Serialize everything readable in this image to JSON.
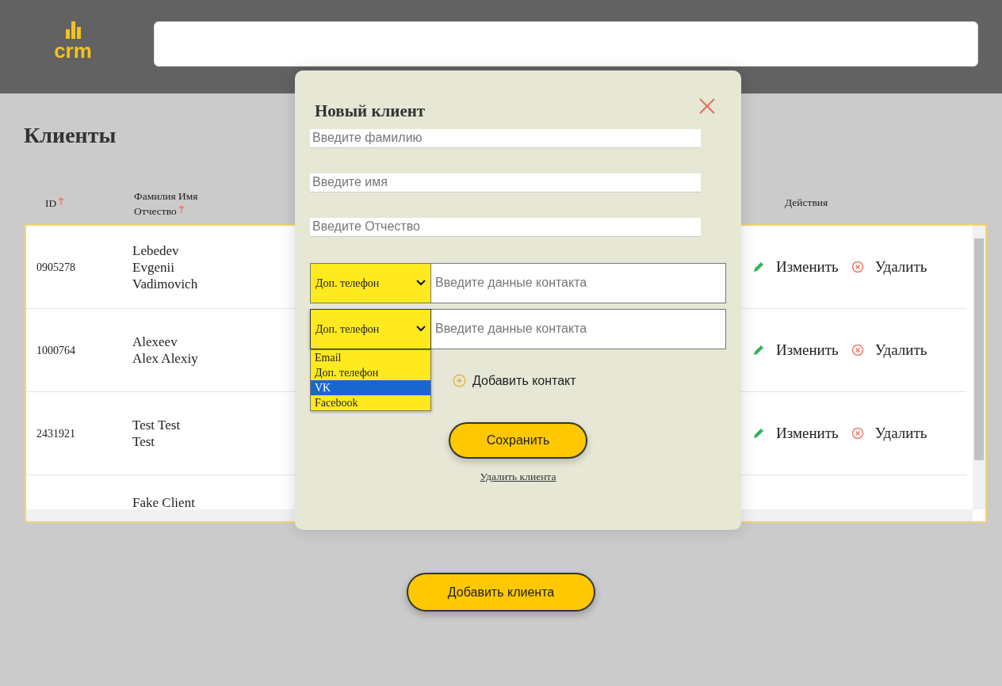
{
  "header": {
    "logo": "crm"
  },
  "page_title": "Клиенты",
  "table": {
    "columns": [
      {
        "label": "ID",
        "sort_ascending": true
      },
      {
        "label": "Фамилия Имя Отчество",
        "sort_ascending": true
      },
      {
        "label": "Действия"
      }
    ],
    "rows": [
      {
        "id": "0905278",
        "name_lines": [
          "Lebedev",
          "Evgenii",
          "Vadimovich"
        ],
        "edit": "Изменить",
        "delete": "Удалить"
      },
      {
        "id": "1000764",
        "name_lines": [
          "Alexeev",
          "Alex Alexiy"
        ],
        "edit": "Изменить",
        "delete": "Удалить"
      },
      {
        "id": "2431921",
        "name_lines": [
          "Test Test",
          "Test"
        ],
        "edit": "Изменить",
        "delete": "Удалить"
      },
      {
        "name_lines": [
          "Fake Client"
        ]
      }
    ]
  },
  "add_client_button": "Добавить клиента",
  "modal": {
    "title": "Новый клиент",
    "fields": [
      {
        "placeholder": "Введите фамилию"
      },
      {
        "placeholder": "Введите имя"
      },
      {
        "placeholder": "Введите Отчество"
      }
    ],
    "contacts": [
      {
        "type": "Доп. телефон",
        "placeholder": "Введите данные контакта",
        "expanded": false
      },
      {
        "type": "Доп. телефон",
        "placeholder": "Введите данные контакта",
        "expanded": true
      }
    ],
    "contact_options": [
      {
        "label": "Email",
        "selected": false
      },
      {
        "label": "Доп. телефон",
        "selected": false
      },
      {
        "label": "VK",
        "selected": true
      },
      {
        "label": "Facebook",
        "selected": false
      }
    ],
    "add_contact": "Добавить контакт",
    "save_button": "Сохранить",
    "delete_link": "Удалить клиента"
  }
}
